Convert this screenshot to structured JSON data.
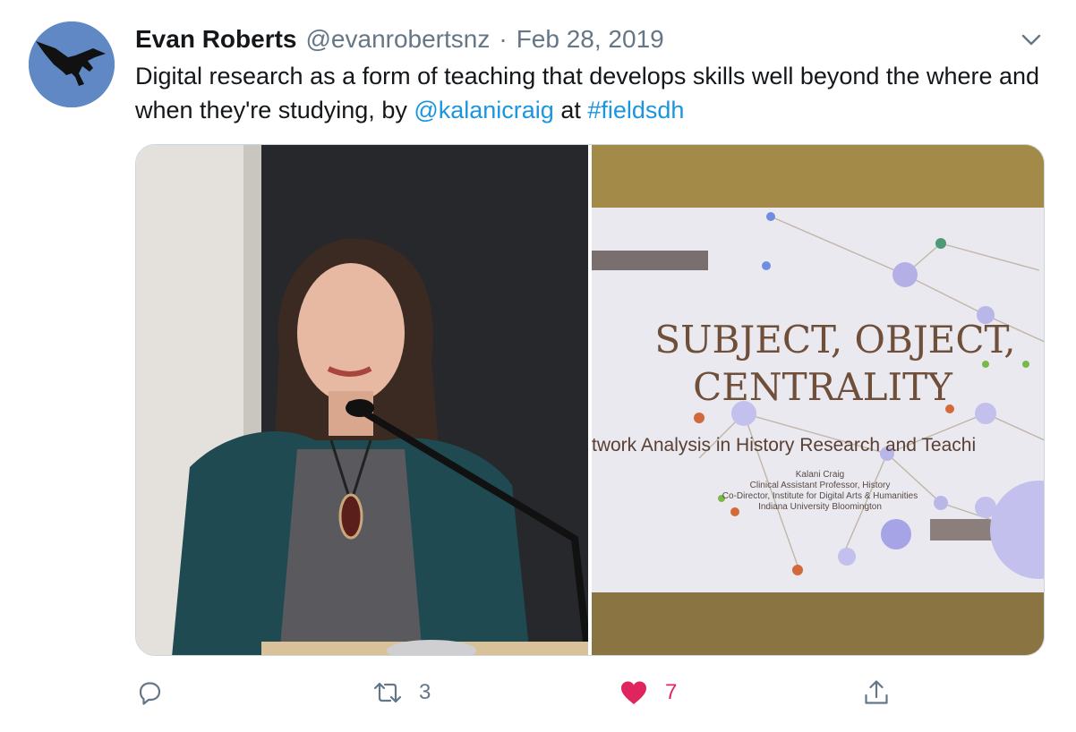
{
  "tweet": {
    "author_name": "Evan Roberts",
    "handle": "@evanrobertsnz",
    "separator": "·",
    "date": "Feb 28, 2019",
    "text_part1": "Digital research as a form of teaching that develops skills well beyond the where and when they're studying, by ",
    "mention": "@kalanicraig",
    "text_part2": " at ",
    "hashtag": "#fieldsdh"
  },
  "slide": {
    "title_line1": "SUBJECT, OBJECT,",
    "title_line2": "CENTRALITY",
    "subtitle": "twork Analysis in History Research and Teachi",
    "presenter": "Kalani Craig",
    "role1": "Clinical Assistant Professor, History",
    "role2": "Co-Director, Institute for Digital Arts & Humanities",
    "institution": "Indiana University Bloomington"
  },
  "actions": {
    "reply_icon": "reply-icon",
    "retweet_icon": "retweet-icon",
    "retweet_count": "3",
    "like_icon": "heart-icon",
    "like_count": "7",
    "share_icon": "share-icon"
  },
  "colors": {
    "link": "#1b95e0",
    "secondary_text": "#657786",
    "like": "#e0245e"
  }
}
